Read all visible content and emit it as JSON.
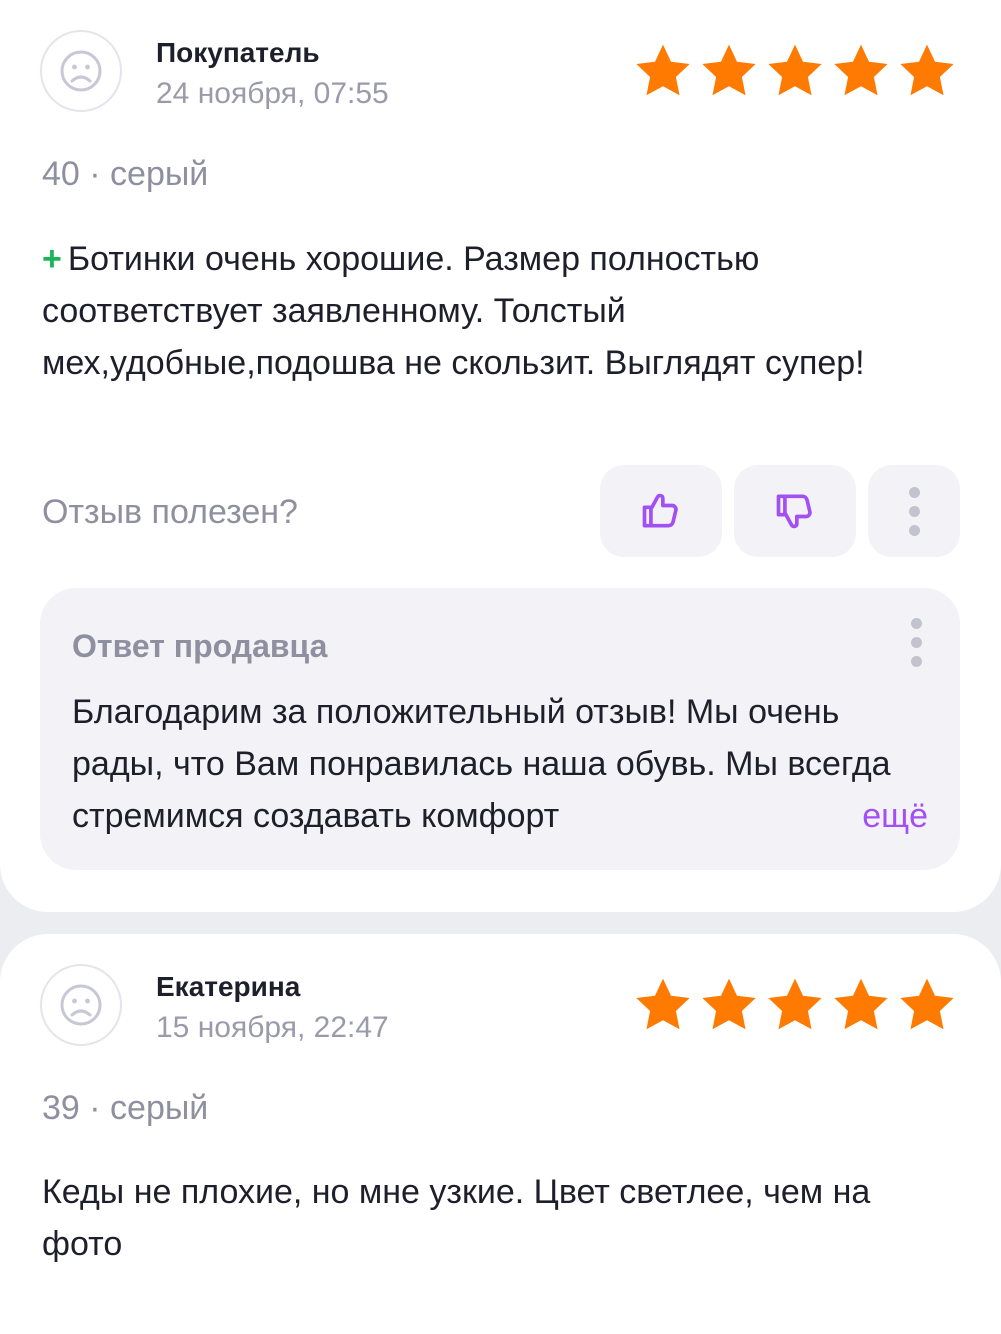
{
  "reviews": [
    {
      "author": "Покупатель",
      "date": "24 ноября, 07:55",
      "rating": 5,
      "meta": "40 · серый",
      "plus_sign": "+",
      "text": "Ботинки очень хорошие. Размер полностью соответствует заявленному. Толстый мех,удобные,подошва не скользит. Выглядят супер!",
      "helpful_question": "Отзыв полезен?",
      "seller_reply": {
        "title": "Ответ продавца",
        "text": "Благодарим за положительный отзыв! Мы очень рады, что Вам понравилась наша обувь. Мы всегда стремимся создавать комфорт",
        "more_label": "ещё"
      }
    },
    {
      "author": "Екатерина",
      "date": "15 ноября, 22:47",
      "rating": 5,
      "meta": "39 · серый",
      "text": "Кеды не плохие, но мне узкие. Цвет светлее, чем на фото"
    }
  ],
  "icons": {
    "avatar": "sad-face-icon",
    "star": "star-icon",
    "like": "thumbs-up-icon",
    "dislike": "thumbs-down-icon",
    "more": "more-vertical-icon"
  },
  "colors": {
    "star": "#ff7a00",
    "accent": "#a24ff3",
    "plus": "#19b558",
    "muted_text": "#8f8fa0"
  }
}
